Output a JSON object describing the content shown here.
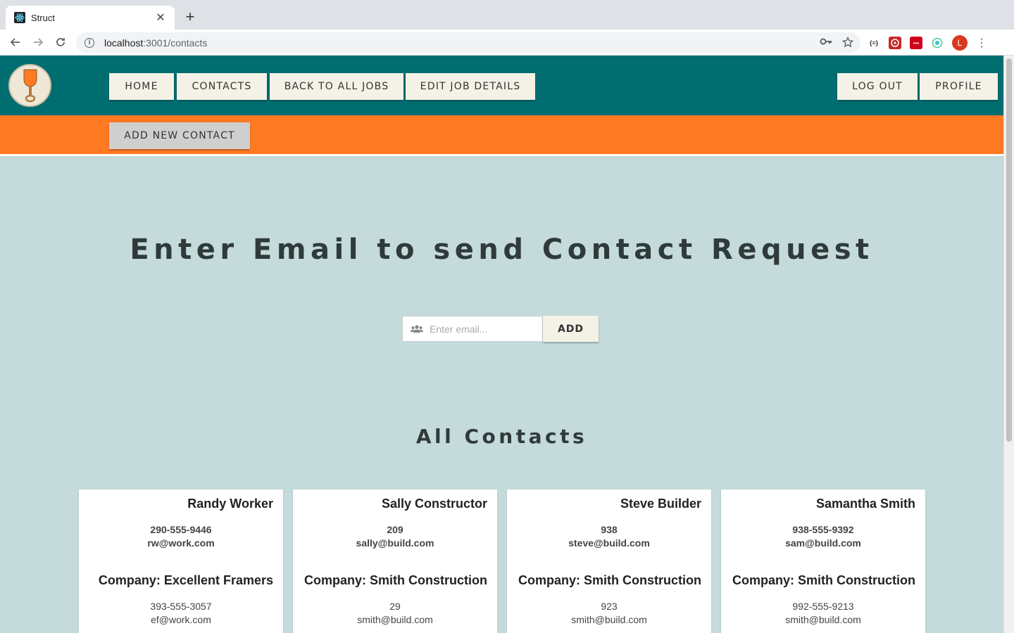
{
  "browser": {
    "tab_title": "Struct",
    "tab_close": "✕",
    "new_tab": "+",
    "url_host": "localhost",
    "url_path": ":3001/contacts",
    "avatar_letter": "L"
  },
  "nav": {
    "home": "HOME",
    "contacts": "CONTACTS",
    "back_to_jobs": "BACK TO ALL JOBS",
    "edit_job": "EDIT JOB DETAILS",
    "log_out": "LOG OUT",
    "profile": "PROFILE"
  },
  "subnav": {
    "add_new_contact": "ADD NEW CONTACT"
  },
  "request": {
    "heading": "Enter Email to send Contact Request",
    "email_placeholder": "Enter email...",
    "add_label": "ADD"
  },
  "contacts": {
    "heading": "All Contacts",
    "cards": [
      {
        "name": "Randy Worker",
        "phone": "290-555-9446",
        "email": "rw@work.com",
        "company": "Company: Excellent Framers",
        "company_phone": "393-555-3057",
        "company_email": "ef@work.com"
      },
      {
        "name": "Sally Constructor",
        "phone": "209",
        "email": "sally@build.com",
        "company": "Company: Smith Construction",
        "company_phone": "29",
        "company_email": "smith@build.com"
      },
      {
        "name": "Steve Builder",
        "phone": "938",
        "email": "steve@build.com",
        "company": "Company: Smith Construction",
        "company_phone": "923",
        "company_email": "smith@build.com"
      },
      {
        "name": "Samantha Smith",
        "phone": "938-555-9392",
        "email": "sam@build.com",
        "company": "Company: Smith Construction",
        "company_phone": "992-555-9213",
        "company_email": "smith@build.com"
      }
    ]
  },
  "colors": {
    "header": "#006e70",
    "subbar": "#ff7a22",
    "background": "#c4dadb",
    "button": "#f4f2e6"
  }
}
